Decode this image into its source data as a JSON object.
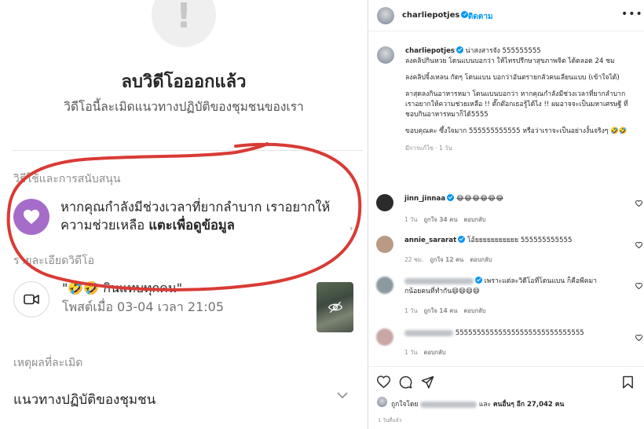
{
  "left": {
    "warning_glyph": "!",
    "title": "ลบวิดีโอออกแล้ว",
    "subtitle": "วิดีโอนี้ละเมิดแนวทางปฏิบัติของชุมชนของเรา",
    "support_label": "วิธีใช้และการสนับสนุน",
    "help_text": "หากคุณกำลังมีช่วงเวลาที่ยากลำบาก เราอยากให้ความช่วยเหลือ",
    "help_link": "แตะเพื่อดูข้อมูล",
    "video_details_label": "รายละเอียดวิดีโอ",
    "video_caption": "\"🤣🤣 กินแทบทุกคน\"",
    "video_posted": "โพสต์เมื่อ 03-04 เวลา 21:05",
    "violation_label": "เหตุผลที่ละเมิด",
    "violation_value": "แนวทางปฏิบัติของชุมชน",
    "annotation_color": "#d93b35"
  },
  "post": {
    "username": "charliepotjes",
    "follow_label": "ติดตาม",
    "more_label": "•••",
    "caption_prefix": "น่าสงสารจัง 555555555",
    "caption_lines": [
      "ลงคลิปกินหวย โดนแบนบอกว่า ให้ไทรปรึกษาสุขภาพจิต ได้ตลอด 24 ชม",
      "ลงคลิปจิ้งเหลน กัดๆ โดนแบน บอกว่าอันตรายกลัวคนเลียนแบบ (เข้าใจได้)",
      "ลาสุดลงกินอาหารหมา โดนแบนบอกว่า หากคุณกำลังมีช่วงเวลาที่ยากลำบาก เราอยากให้ความช่วยเหลือ !! ตั๊กต๊อกเธอรู้ได้ไง !! ผมอาจจะเป็นมหาเศรษฐี ที่ชอบกินอาหารหมาก็ได้5555",
      "ขอบคุณคะ ซึ้งใจมาก 555555555555 หรือว่าเราจะเป็นอย่างงั้นจริงๆ 🤣🤣"
    ],
    "caption_meta": "มีการแก้ไข · 1 วัน",
    "comments": [
      {
        "user": "jinn_jinnaa",
        "text": "😂😂😂😂😂😂",
        "time": "1 วัน",
        "likes": "ถูกใจ 34 คน",
        "reply": "ตอบกลับ",
        "avatar_color": "#2b2b2b"
      },
      {
        "user": "annie_sararat",
        "text": "โอ้ยยยยยยยยยยย 555555555555",
        "time": "22 ชม.",
        "likes": "ถูกใจ 12 คน",
        "reply": "ตอบกลับ",
        "avatar_color": "#b99a84"
      },
      {
        "user": "",
        "text": "เพราะแต่ละวิดีโอที่โดนแบน ก็คือพีคมากน้อยคนที่ทำกัน😄😄😄😄",
        "time": "1 วัน",
        "likes": "ถูกใจ 14 คน",
        "reply": "ตอบกลับ",
        "avatar_color": "#8a9aa0"
      },
      {
        "user": "",
        "text": "555555555555555555555555555555",
        "time": "1 วัน",
        "likes": "",
        "reply": "ตอบกลับ",
        "avatar_color": "#c9a7a5"
      }
    ],
    "likes_prefix": "ถูกใจโดย",
    "likes_suffix_and": "และ",
    "likes_bold": "คนอื่นๆ อีก 27,042 คน",
    "time_ago": "1 วันที่แล้ว"
  }
}
